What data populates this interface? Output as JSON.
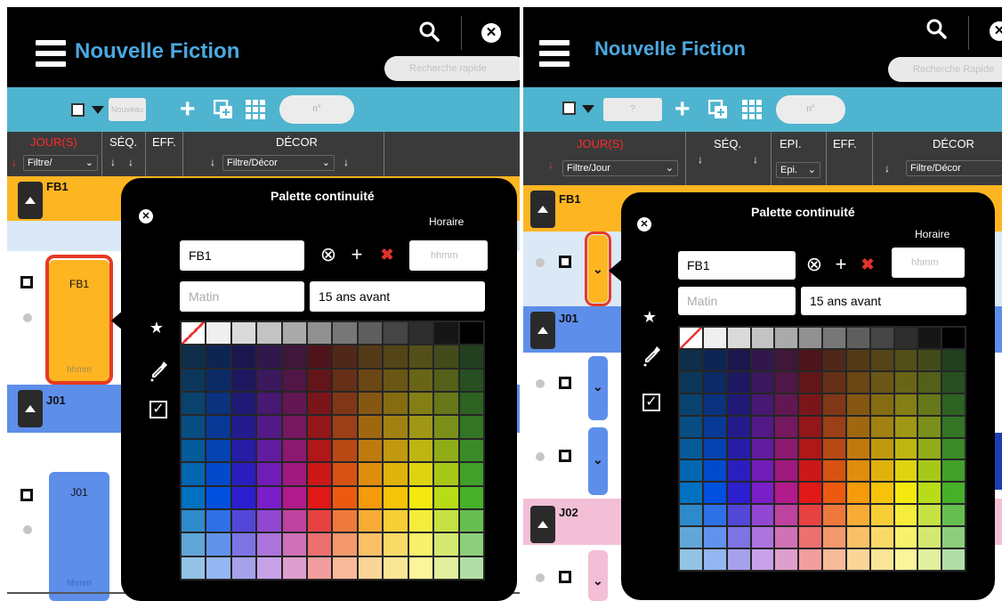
{
  "left": {
    "app_title": "Nouvelle Fiction",
    "quick_search_placeholder": "Recherche rapide",
    "toolbar": {
      "field_placeholder": "Nouveau",
      "pill_placeholder": "n°"
    },
    "header": {
      "jours": "JOUR(S)",
      "seq": "SÉQ.",
      "eff": "EFF.",
      "decor": "DÉCOR",
      "filter_jour": "Filtre/",
      "filter_decor": "Filtre/Décor"
    },
    "rows": [
      {
        "label": "FB1",
        "card_label": "FB1",
        "card_time": "hhmm",
        "color": "#fdb521",
        "band": "#dbe8f5"
      },
      {
        "label": "J01",
        "card_label": "J01",
        "card_time": "hhmm",
        "color": "#5d8eea",
        "band": "#ffffff"
      }
    ],
    "palette": {
      "title": "Palette continuité",
      "horaire_label": "Horaire",
      "name_value": "FB1",
      "horaire_placeholder": "hhmm",
      "moment_placeholder": "Matin",
      "description_value": "15 ans avant",
      "star": "★",
      "check": "✓"
    }
  },
  "right": {
    "app_title": "Nouvelle Fiction",
    "quick_search_placeholder": "Recherche Rapide",
    "toolbar": {
      "field_placeholder": "?",
      "pill_placeholder": "n°"
    },
    "header": {
      "jours": "JOUR(S)",
      "seq": "SÉQ.",
      "epi": "EPI.",
      "eff": "EFF.",
      "decor": "DÉCOR",
      "filter_jour": "Filtre/Jour",
      "filter_epi": "Epi.",
      "filter_decor": "Filtre/Décor"
    },
    "rows": [
      {
        "label": "FB1",
        "color": "#fdb521"
      },
      {
        "label": "J01",
        "color": "#5d8eea"
      },
      {
        "label": "J02",
        "color": "#f2bfd7"
      }
    ],
    "palette": {
      "title": "Palette continuité",
      "horaire_label": "Horaire",
      "name_value": "FB1",
      "horaire_placeholder": "hhmm",
      "moment_placeholder": "Matin",
      "description_value": "15 ans avant",
      "star": "★",
      "check": "✓"
    }
  },
  "colors": {
    "title_blue": "#4ba8e0",
    "toolbar_teal": "#4fb4cf",
    "header_gray": "#3a3a3a",
    "selection_red": "#e53a25"
  },
  "color_grid": {
    "gray_row": [
      "#ffffff",
      "#efefef",
      "#dadada",
      "#c3c3c3",
      "#aaaaaa",
      "#919191",
      "#777777",
      "#5e5e5e",
      "#454545",
      "#2e2e2e",
      "#161616",
      "#000000"
    ],
    "hue_columns": [
      "#0070c0",
      "#0050e0",
      "#2c1fd0",
      "#7a1ec8",
      "#b01a8a",
      "#e01818",
      "#ec5a12",
      "#f59a0a",
      "#f6c30a",
      "#f4e810",
      "#b8dc18",
      "#46b02a"
    ]
  }
}
